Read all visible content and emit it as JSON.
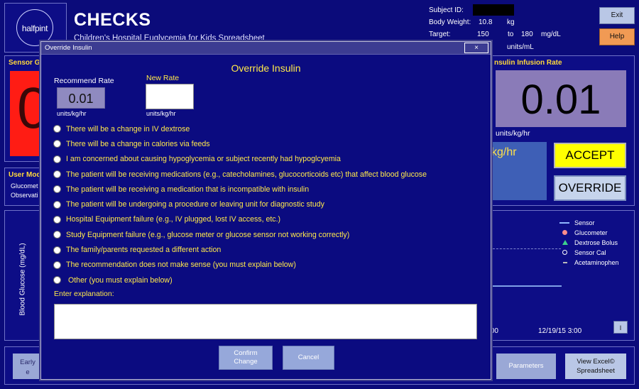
{
  "app": {
    "logo_text": "halfpint",
    "title": "CHECKS",
    "subtitle": "Children's Hospital Euglycemia for Kids Spreadsheet"
  },
  "subject": {
    "id_label": "Subject ID:",
    "weight_label": "Body Weight:",
    "weight_value": "10.8",
    "weight_unit": "kg",
    "target_label": "Target:",
    "target_low": "150",
    "target_to": "to",
    "target_high": "180",
    "target_unit": "mg/dL",
    "conc_unit": "units/mL"
  },
  "header_buttons": {
    "exit": "Exit",
    "help": "Help"
  },
  "background": {
    "sensor_label": "Sensor Gl",
    "sensor_digit": "0",
    "usermode_label": "User Mod",
    "usermode_items": [
      "Glucomet",
      "Observati"
    ],
    "rate_label": "nsulin Infusion Rate",
    "rate_value": "0.01",
    "rate_unit": "units/kg/hr",
    "kghr_text": "kg/hr",
    "accept": "ACCEPT",
    "override": "OVERRIDE",
    "yaxis_label": "Blood   Glucose   (mg/dL)",
    "legend": [
      {
        "icon": "line-icon",
        "label": "Sensor"
      },
      {
        "icon": "dot-icon",
        "label": "Glucometer"
      },
      {
        "icon": "triangle-icon",
        "label": "Dextrose Bolus"
      },
      {
        "icon": "circle-icon",
        "label": "Sensor Cal"
      },
      {
        "icon": "dash-icon",
        "label": "Acetaminophen"
      }
    ],
    "x_tick_a": ":00",
    "x_tick_b": "12/19/15 3:00",
    "i_button": "I",
    "early_button": [
      "Early",
      "e"
    ],
    "parameters_button": "Parameters",
    "view_excel_button": [
      "View Excel©",
      "Spreadsheet"
    ]
  },
  "modal": {
    "window_title": "Override Insulin",
    "heading": "Override Insulin",
    "close": "×",
    "recommend_label": "Recommend   Rate",
    "recommend_value": "0.01",
    "recommend_unit": "units/kg/hr",
    "new_rate_label": "New Rate",
    "new_rate_value": "",
    "new_rate_unit": "units/kg/hr",
    "reasons": [
      "There will be a change in IV dextrose",
      "There will be a change in calories via feeds",
      "I am concerned about causing hypoglycemia or subject recently had hypoglcyemia",
      "The patient will be receiving medications (e.g., catecholamines, glucocorticoids etc) that affect blood glucose",
      "The patient will be receiving a medication that is incompatible with insulin",
      "The patient will be undergoing a procedure or leaving unit for diagnostic study",
      "Hospital Equipment failure (e.g., IV plugged, lost IV access, etc.)",
      "Study Equipment failure (e.g.,  glucose meter or glucose sensor not working correctly)",
      "The family/parents requested a different action",
      "The recommendation does not make sense (you must explain below)",
      "Other (you must explain below)"
    ],
    "explain_label": "Enter explanation:",
    "explain_value": "",
    "confirm_button": [
      "Confirm",
      "Change"
    ],
    "cancel_button": "Cancel"
  }
}
